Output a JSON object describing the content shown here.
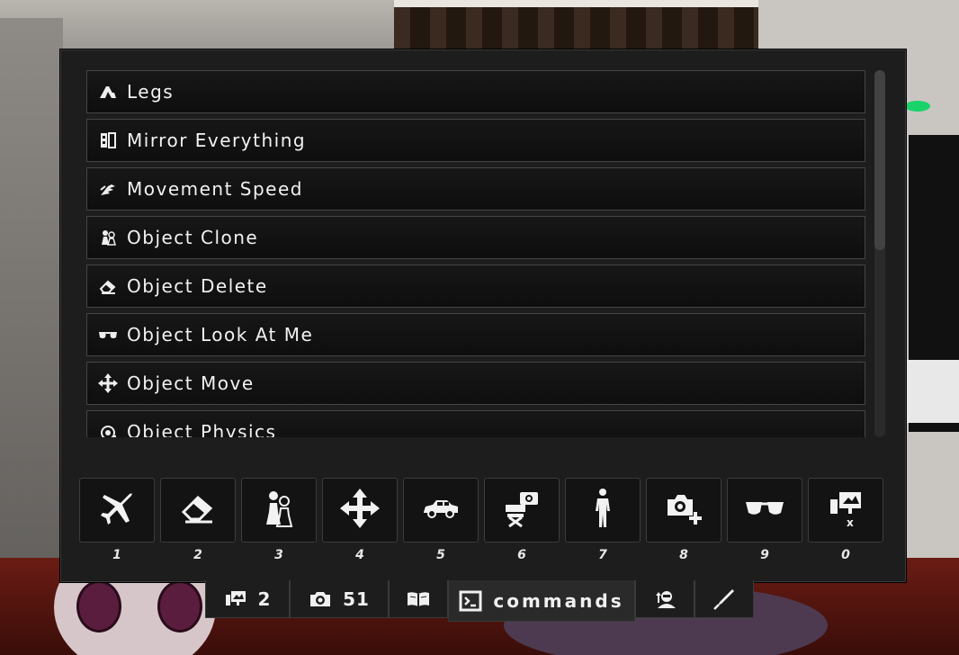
{
  "command_list": {
    "items": [
      {
        "label": "Legs",
        "icon": "legs-icon"
      },
      {
        "label": "Mirror Everything",
        "icon": "mirror-icon"
      },
      {
        "label": "Movement Speed",
        "icon": "speed-icon"
      },
      {
        "label": "Object Clone",
        "icon": "clone-icon"
      },
      {
        "label": "Object Delete",
        "icon": "eraser-icon"
      },
      {
        "label": "Object Look At Me",
        "icon": "glasses-icon"
      },
      {
        "label": "Object Move",
        "icon": "move-arrows-icon"
      },
      {
        "label": "Object Physics",
        "icon": "physics-icon"
      }
    ]
  },
  "hotbar": {
    "slots": [
      {
        "key": "1",
        "icon": "airplane-icon"
      },
      {
        "key": "2",
        "icon": "eraser-icon"
      },
      {
        "key": "3",
        "icon": "chess-clone-icon"
      },
      {
        "key": "4",
        "icon": "move-arrows-icon"
      },
      {
        "key": "5",
        "icon": "car-icon"
      },
      {
        "key": "6",
        "icon": "director-camera-icon"
      },
      {
        "key": "7",
        "icon": "person-icon"
      },
      {
        "key": "8",
        "icon": "camera-plus-icon"
      },
      {
        "key": "9",
        "icon": "glasses-icon"
      },
      {
        "key": "0",
        "icon": "screen-close-icon"
      }
    ]
  },
  "tabs": [
    {
      "id": "worlds",
      "icon": "screen-icon",
      "label": "2",
      "active": false
    },
    {
      "id": "photos",
      "icon": "camera-icon",
      "label": "51",
      "active": false
    },
    {
      "id": "book",
      "icon": "book-icon",
      "label": "",
      "active": false
    },
    {
      "id": "commands",
      "icon": "terminal-icon",
      "label": "commands",
      "active": true
    },
    {
      "id": "avatar",
      "icon": "avatar-icon",
      "label": "",
      "active": false
    },
    {
      "id": "tools",
      "icon": "pen-icon",
      "label": "",
      "active": false
    }
  ],
  "colors": {
    "panel_bg": "#1d1d1d",
    "item_bg": "#0e0e0e",
    "border": "#454545",
    "text": "#f2f2f2"
  }
}
